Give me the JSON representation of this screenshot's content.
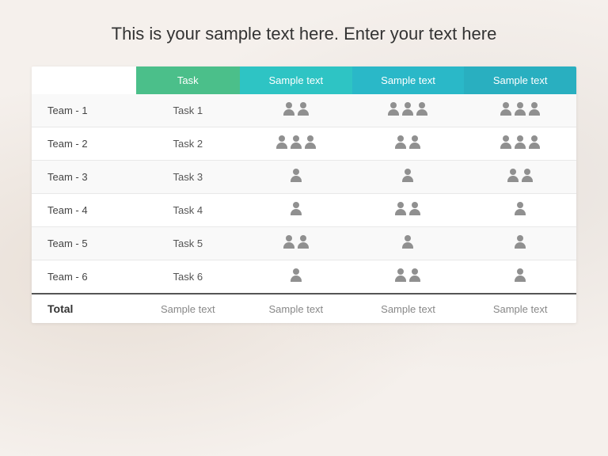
{
  "title": "This is your sample text here. Enter your text here",
  "header": {
    "col0": "",
    "col1": "Task",
    "col2": "Sample text",
    "col3": "Sample text",
    "col4": "Sample text"
  },
  "rows": [
    {
      "team": "Team - 1",
      "task": "Task 1",
      "c2_count": 2,
      "c3_count": 3,
      "c4_count": 3
    },
    {
      "team": "Team - 2",
      "task": "Task 2",
      "c2_count": 3,
      "c3_count": 2,
      "c4_count": 3
    },
    {
      "team": "Team - 3",
      "task": "Task 3",
      "c2_count": 1,
      "c3_count": 1,
      "c4_count": 2
    },
    {
      "team": "Team - 4",
      "task": "Task 4",
      "c2_count": 1,
      "c3_count": 2,
      "c4_count": 1
    },
    {
      "team": "Team - 5",
      "task": "Task 5",
      "c2_count": 2,
      "c3_count": 1,
      "c4_count": 1
    },
    {
      "team": "Team - 6",
      "task": "Task 6",
      "c2_count": 1,
      "c3_count": 2,
      "c4_count": 1
    }
  ],
  "footer": {
    "label": "Total",
    "c1": "Sample text",
    "c2": "Sample text",
    "c3": "Sample text",
    "c4": "Sample text"
  }
}
